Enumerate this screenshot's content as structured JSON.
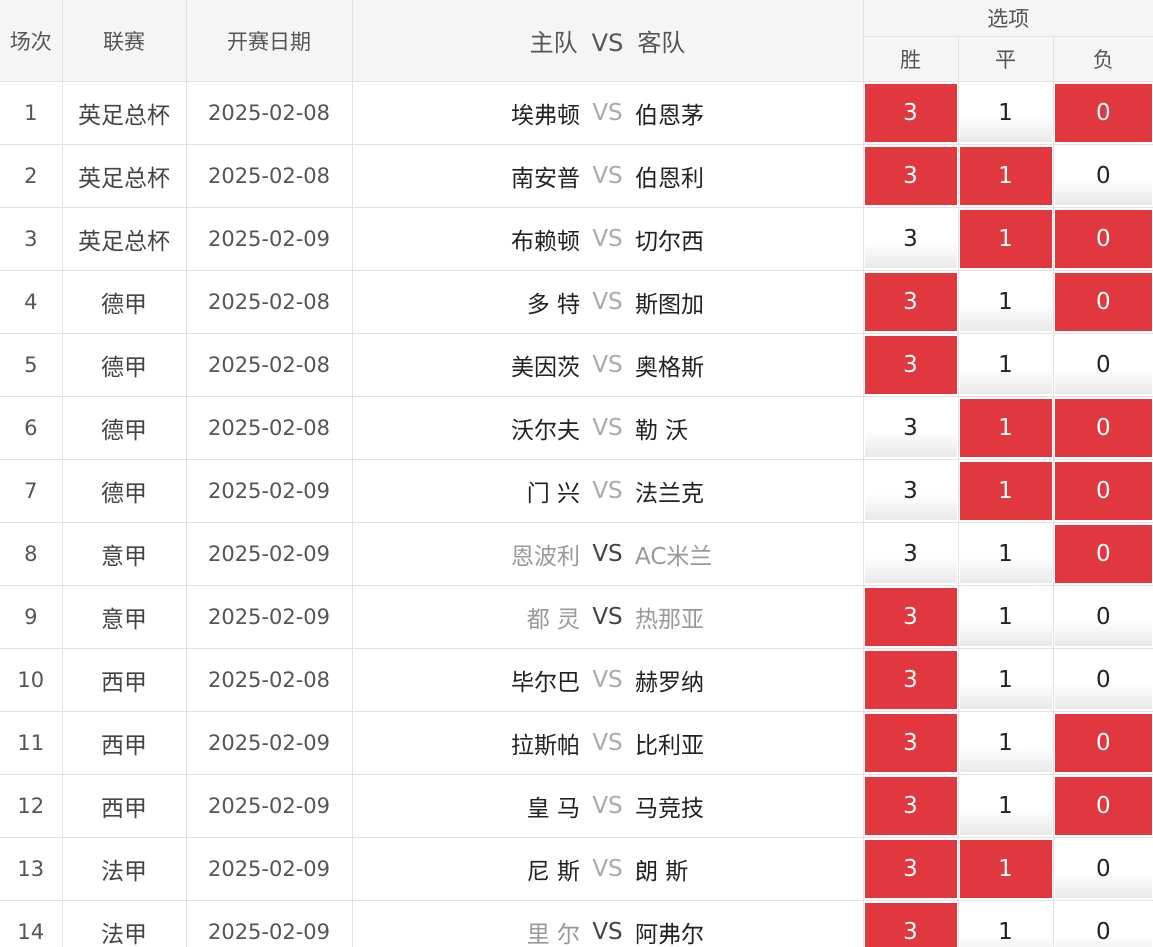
{
  "header": {
    "idx": "场次",
    "league": "联赛",
    "date": "开赛日期",
    "home": "主队",
    "vs": "VS",
    "away": "客队",
    "options_title": "选项",
    "opt_win": "胜",
    "opt_draw": "平",
    "opt_lose": "负"
  },
  "options": {
    "win": "3",
    "draw": "1",
    "lose": "0"
  },
  "colors": {
    "selected": "#e0383e",
    "header_bg": "#f5f5f5",
    "dim_text": "#999999"
  },
  "rows": [
    {
      "idx": "1",
      "league": "英足总杯",
      "date": "2025-02-08",
      "home": "埃弗顿",
      "vs": "VS",
      "away": "伯恩茅",
      "win": "3",
      "draw": "1",
      "lose": "0"
    },
    {
      "idx": "2",
      "league": "英足总杯",
      "date": "2025-02-08",
      "home": "南安普",
      "vs": "VS",
      "away": "伯恩利",
      "win": "3",
      "draw": "1",
      "lose": "0"
    },
    {
      "idx": "3",
      "league": "英足总杯",
      "date": "2025-02-09",
      "home": "布赖顿",
      "vs": "VS",
      "away": "切尔西",
      "win": "3",
      "draw": "1",
      "lose": "0"
    },
    {
      "idx": "4",
      "league": "德甲",
      "date": "2025-02-08",
      "home": "多 特",
      "vs": "VS",
      "away": "斯图加",
      "win": "3",
      "draw": "1",
      "lose": "0"
    },
    {
      "idx": "5",
      "league": "德甲",
      "date": "2025-02-08",
      "home": "美因茨",
      "vs": "VS",
      "away": "奥格斯",
      "win": "3",
      "draw": "1",
      "lose": "0"
    },
    {
      "idx": "6",
      "league": "德甲",
      "date": "2025-02-08",
      "home": "沃尔夫",
      "vs": "VS",
      "away": "勒 沃",
      "win": "3",
      "draw": "1",
      "lose": "0"
    },
    {
      "idx": "7",
      "league": "德甲",
      "date": "2025-02-09",
      "home": "门 兴",
      "vs": "VS",
      "away": "法兰克",
      "win": "3",
      "draw": "1",
      "lose": "0"
    },
    {
      "idx": "8",
      "league": "意甲",
      "date": "2025-02-09",
      "home": "恩波利",
      "vs": "VS",
      "away": "AC米兰",
      "win": "3",
      "draw": "1",
      "lose": "0"
    },
    {
      "idx": "9",
      "league": "意甲",
      "date": "2025-02-09",
      "home": "都 灵",
      "vs": "VS",
      "away": "热那亚",
      "win": "3",
      "draw": "1",
      "lose": "0"
    },
    {
      "idx": "10",
      "league": "西甲",
      "date": "2025-02-08",
      "home": "毕尔巴",
      "vs": "VS",
      "away": "赫罗纳",
      "win": "3",
      "draw": "1",
      "lose": "0"
    },
    {
      "idx": "11",
      "league": "西甲",
      "date": "2025-02-09",
      "home": "拉斯帕",
      "vs": "VS",
      "away": "比利亚",
      "win": "3",
      "draw": "1",
      "lose": "0"
    },
    {
      "idx": "12",
      "league": "西甲",
      "date": "2025-02-09",
      "home": "皇 马",
      "vs": "VS",
      "away": "马竞技",
      "win": "3",
      "draw": "1",
      "lose": "0"
    },
    {
      "idx": "13",
      "league": "法甲",
      "date": "2025-02-09",
      "home": "尼 斯",
      "vs": "VS",
      "away": "朗 斯",
      "win": "3",
      "draw": "1",
      "lose": "0"
    },
    {
      "idx": "14",
      "league": "法甲",
      "date": "2025-02-09",
      "home": "里 尔",
      "vs": "VS",
      "away": "阿弗尔",
      "win": "3",
      "draw": "1",
      "lose": "0"
    }
  ]
}
